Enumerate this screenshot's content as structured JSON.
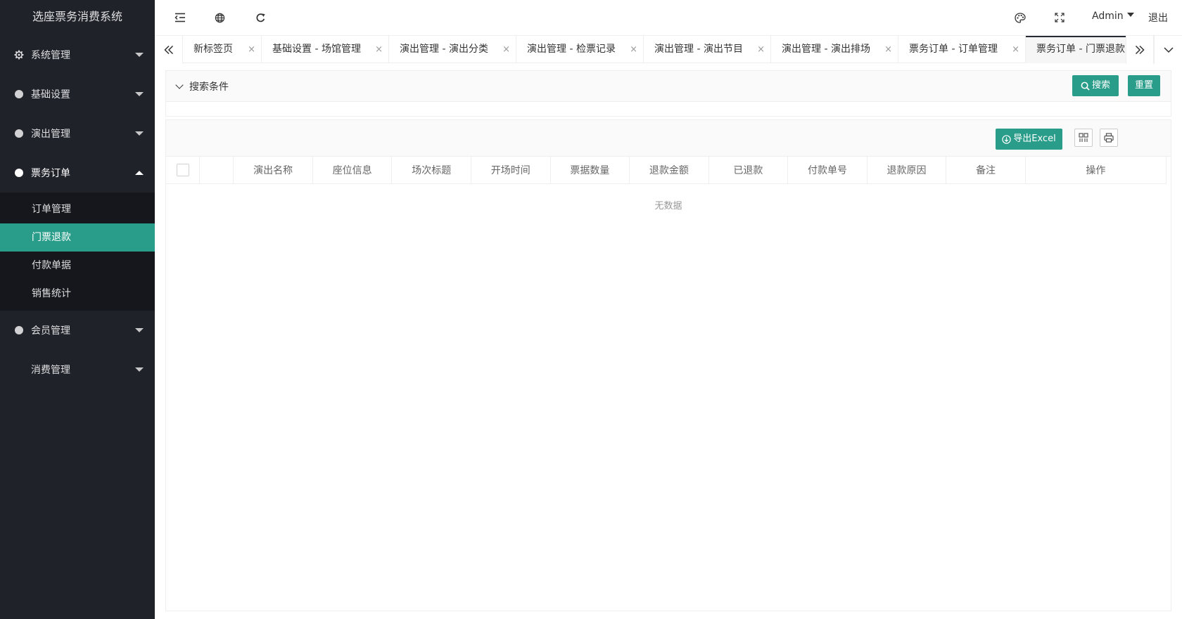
{
  "app": {
    "title": "选座票务消费系统"
  },
  "sidebar": {
    "items": [
      {
        "label": "系统管理"
      },
      {
        "label": "基础设置"
      },
      {
        "label": "演出管理"
      },
      {
        "label": "票务订单",
        "children": [
          {
            "label": "订单管理"
          },
          {
            "label": "门票退款"
          },
          {
            "label": "付款单据"
          },
          {
            "label": "销售统计"
          }
        ]
      },
      {
        "label": "会员管理"
      },
      {
        "label": "消费管理"
      }
    ]
  },
  "header": {
    "user": "Admin",
    "logout": "退出"
  },
  "tabs": [
    {
      "label": "新标签页"
    },
    {
      "label": "基础设置 - 场馆管理"
    },
    {
      "label": "演出管理 - 演出分类"
    },
    {
      "label": "演出管理 - 检票记录"
    },
    {
      "label": "演出管理 - 演出节目"
    },
    {
      "label": "演出管理 - 演出排场"
    },
    {
      "label": "票务订单 - 订单管理"
    },
    {
      "label": "票务订单 - 门票退款"
    }
  ],
  "tab_close": "×",
  "search": {
    "title": "搜索条件",
    "search_label": "搜索",
    "reset_label": "重置"
  },
  "table": {
    "export_label": "导出Excel",
    "columns": [
      "演出名称",
      "座位信息",
      "场次标题",
      "开场时间",
      "票据数量",
      "退款金额",
      "已退款",
      "付款单号",
      "退款原因",
      "备注",
      "操作"
    ],
    "empty_text": "无数据"
  },
  "colors": {
    "sidebar_bg": "#20222a",
    "accent": "#2a9d8a",
    "submenu_bg": "#15171c"
  }
}
